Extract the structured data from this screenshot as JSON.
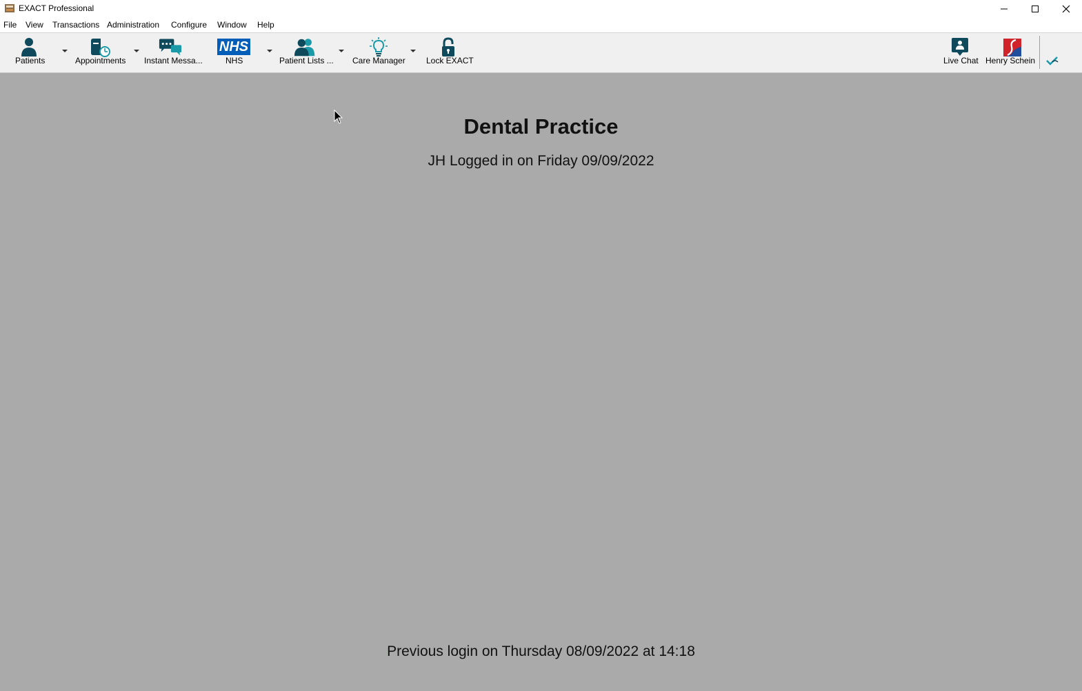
{
  "window": {
    "title": "EXACT Professional",
    "controls": {
      "minimize": "minimize-icon",
      "maximize": "maximize-icon",
      "close": "close-icon"
    }
  },
  "menu": [
    "File",
    "View",
    "Transactions",
    "Administration",
    "Configure",
    "Window",
    "Help"
  ],
  "toolbar": {
    "patients": "Patients",
    "appointments": "Appointments",
    "instant_messages": "Instant Messa...",
    "nhs": "NHS",
    "nhs_logo_text": "NHS",
    "patient_lists": "Patient Lists ...",
    "care_manager": "Care Manager",
    "lock_exact": "Lock EXACT",
    "live_chat": "Live Chat",
    "henry_schein": "Henry Schein"
  },
  "main": {
    "practice_name": "Dental Practice",
    "login_status": "JH Logged in on Friday 09/09/2022",
    "previous_login": "Previous login on Thursday 08/09/2022 at 14:18"
  },
  "colors": {
    "icon_dark": "#0f4a5c",
    "icon_teal": "#1a9aa8",
    "nhs_blue": "#005eb8",
    "workspace": "#a9aaa9",
    "schein_red": "#d0232a",
    "schein_blue": "#1f4f9c"
  }
}
